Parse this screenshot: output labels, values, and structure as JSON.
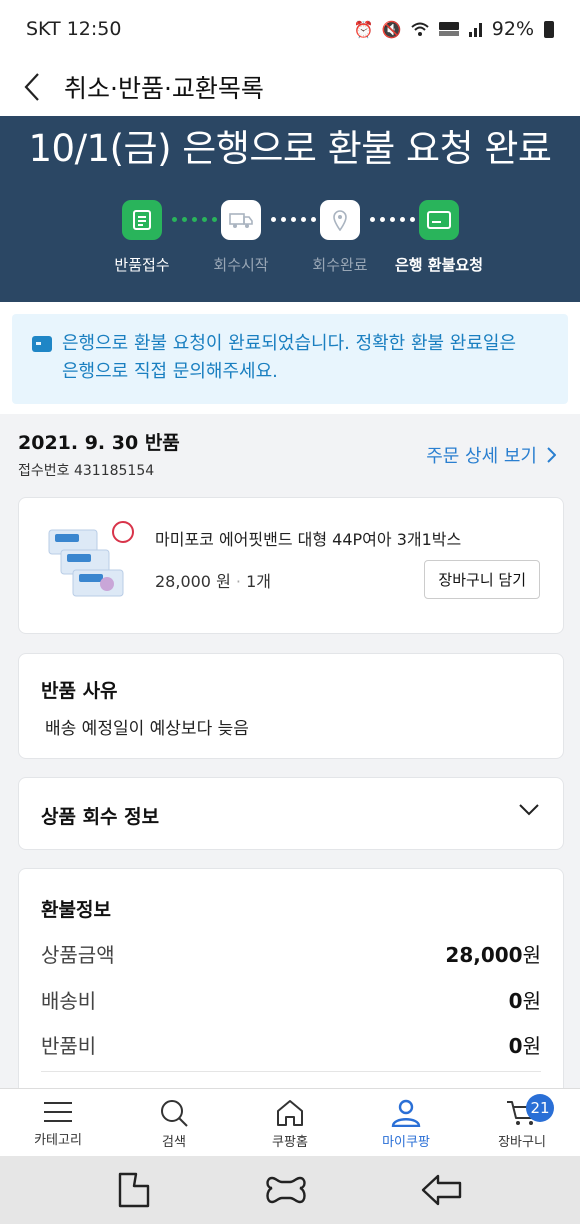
{
  "status_bar": {
    "carrier_time": "SKT 12:50",
    "battery": "92%",
    "icons": [
      "alarm-icon",
      "mute-icon",
      "wifi-icon",
      "hd-voice-icon",
      "signal-icon",
      "battery-icon"
    ]
  },
  "header": {
    "title": "취소·반품·교환목록"
  },
  "hero": {
    "title": "10/1(금) 은행으로 환불 요청 완료",
    "steps": [
      {
        "label": "반품접수",
        "state": "done",
        "icon": "receipt-icon"
      },
      {
        "label": "회수시작",
        "state": "todo",
        "icon": "truck-icon"
      },
      {
        "label": "회수완료",
        "state": "todo",
        "icon": "location-pin-icon"
      },
      {
        "label": "은행 환불요청",
        "state": "current",
        "icon": "bank-card-icon"
      }
    ]
  },
  "notice": {
    "line1": "은행으로 환불 요청이 완료되었습니다. 정확한 환불 완료일은",
    "line2": "은행으로 직접 문의해주세요."
  },
  "order": {
    "date_label": "2021. 9. 30 반품",
    "receipt_label": "접수번호 431185154",
    "detail_link": "주문 상세 보기"
  },
  "product": {
    "name": "마미포코 에어핏밴드 대형 44P여아 3개1박스",
    "price": "28,000 원",
    "separator": "·",
    "qty": "1개",
    "cart_button": "장바구니 담기"
  },
  "reason": {
    "title": "반품 사유",
    "text": "배송 예정일이 예상보다 늦음"
  },
  "collect": {
    "title": "상품 회수 정보"
  },
  "refund": {
    "title": "환불정보",
    "rows": [
      {
        "label": "상품금액",
        "value": "28,000",
        "unit": "원"
      },
      {
        "label": "배송비",
        "value": "0",
        "unit": "원"
      },
      {
        "label": "반품비",
        "value": "0",
        "unit": "원"
      }
    ]
  },
  "bottom_nav": {
    "items": [
      {
        "label": "카테고리",
        "icon": "menu-icon"
      },
      {
        "label": "검색",
        "icon": "search-icon"
      },
      {
        "label": "쿠팡홈",
        "icon": "home-icon"
      },
      {
        "label": "마이쿠팡",
        "icon": "person-icon",
        "active": true
      },
      {
        "label": "장바구니",
        "icon": "cart-icon",
        "badge": "21"
      }
    ]
  },
  "colors": {
    "hero_bg": "#2b4764",
    "step_active": "#29b45b",
    "link_blue": "#2a7fd0",
    "notice_bg": "#e8f5fd",
    "nav_active": "#2a6fd6"
  }
}
